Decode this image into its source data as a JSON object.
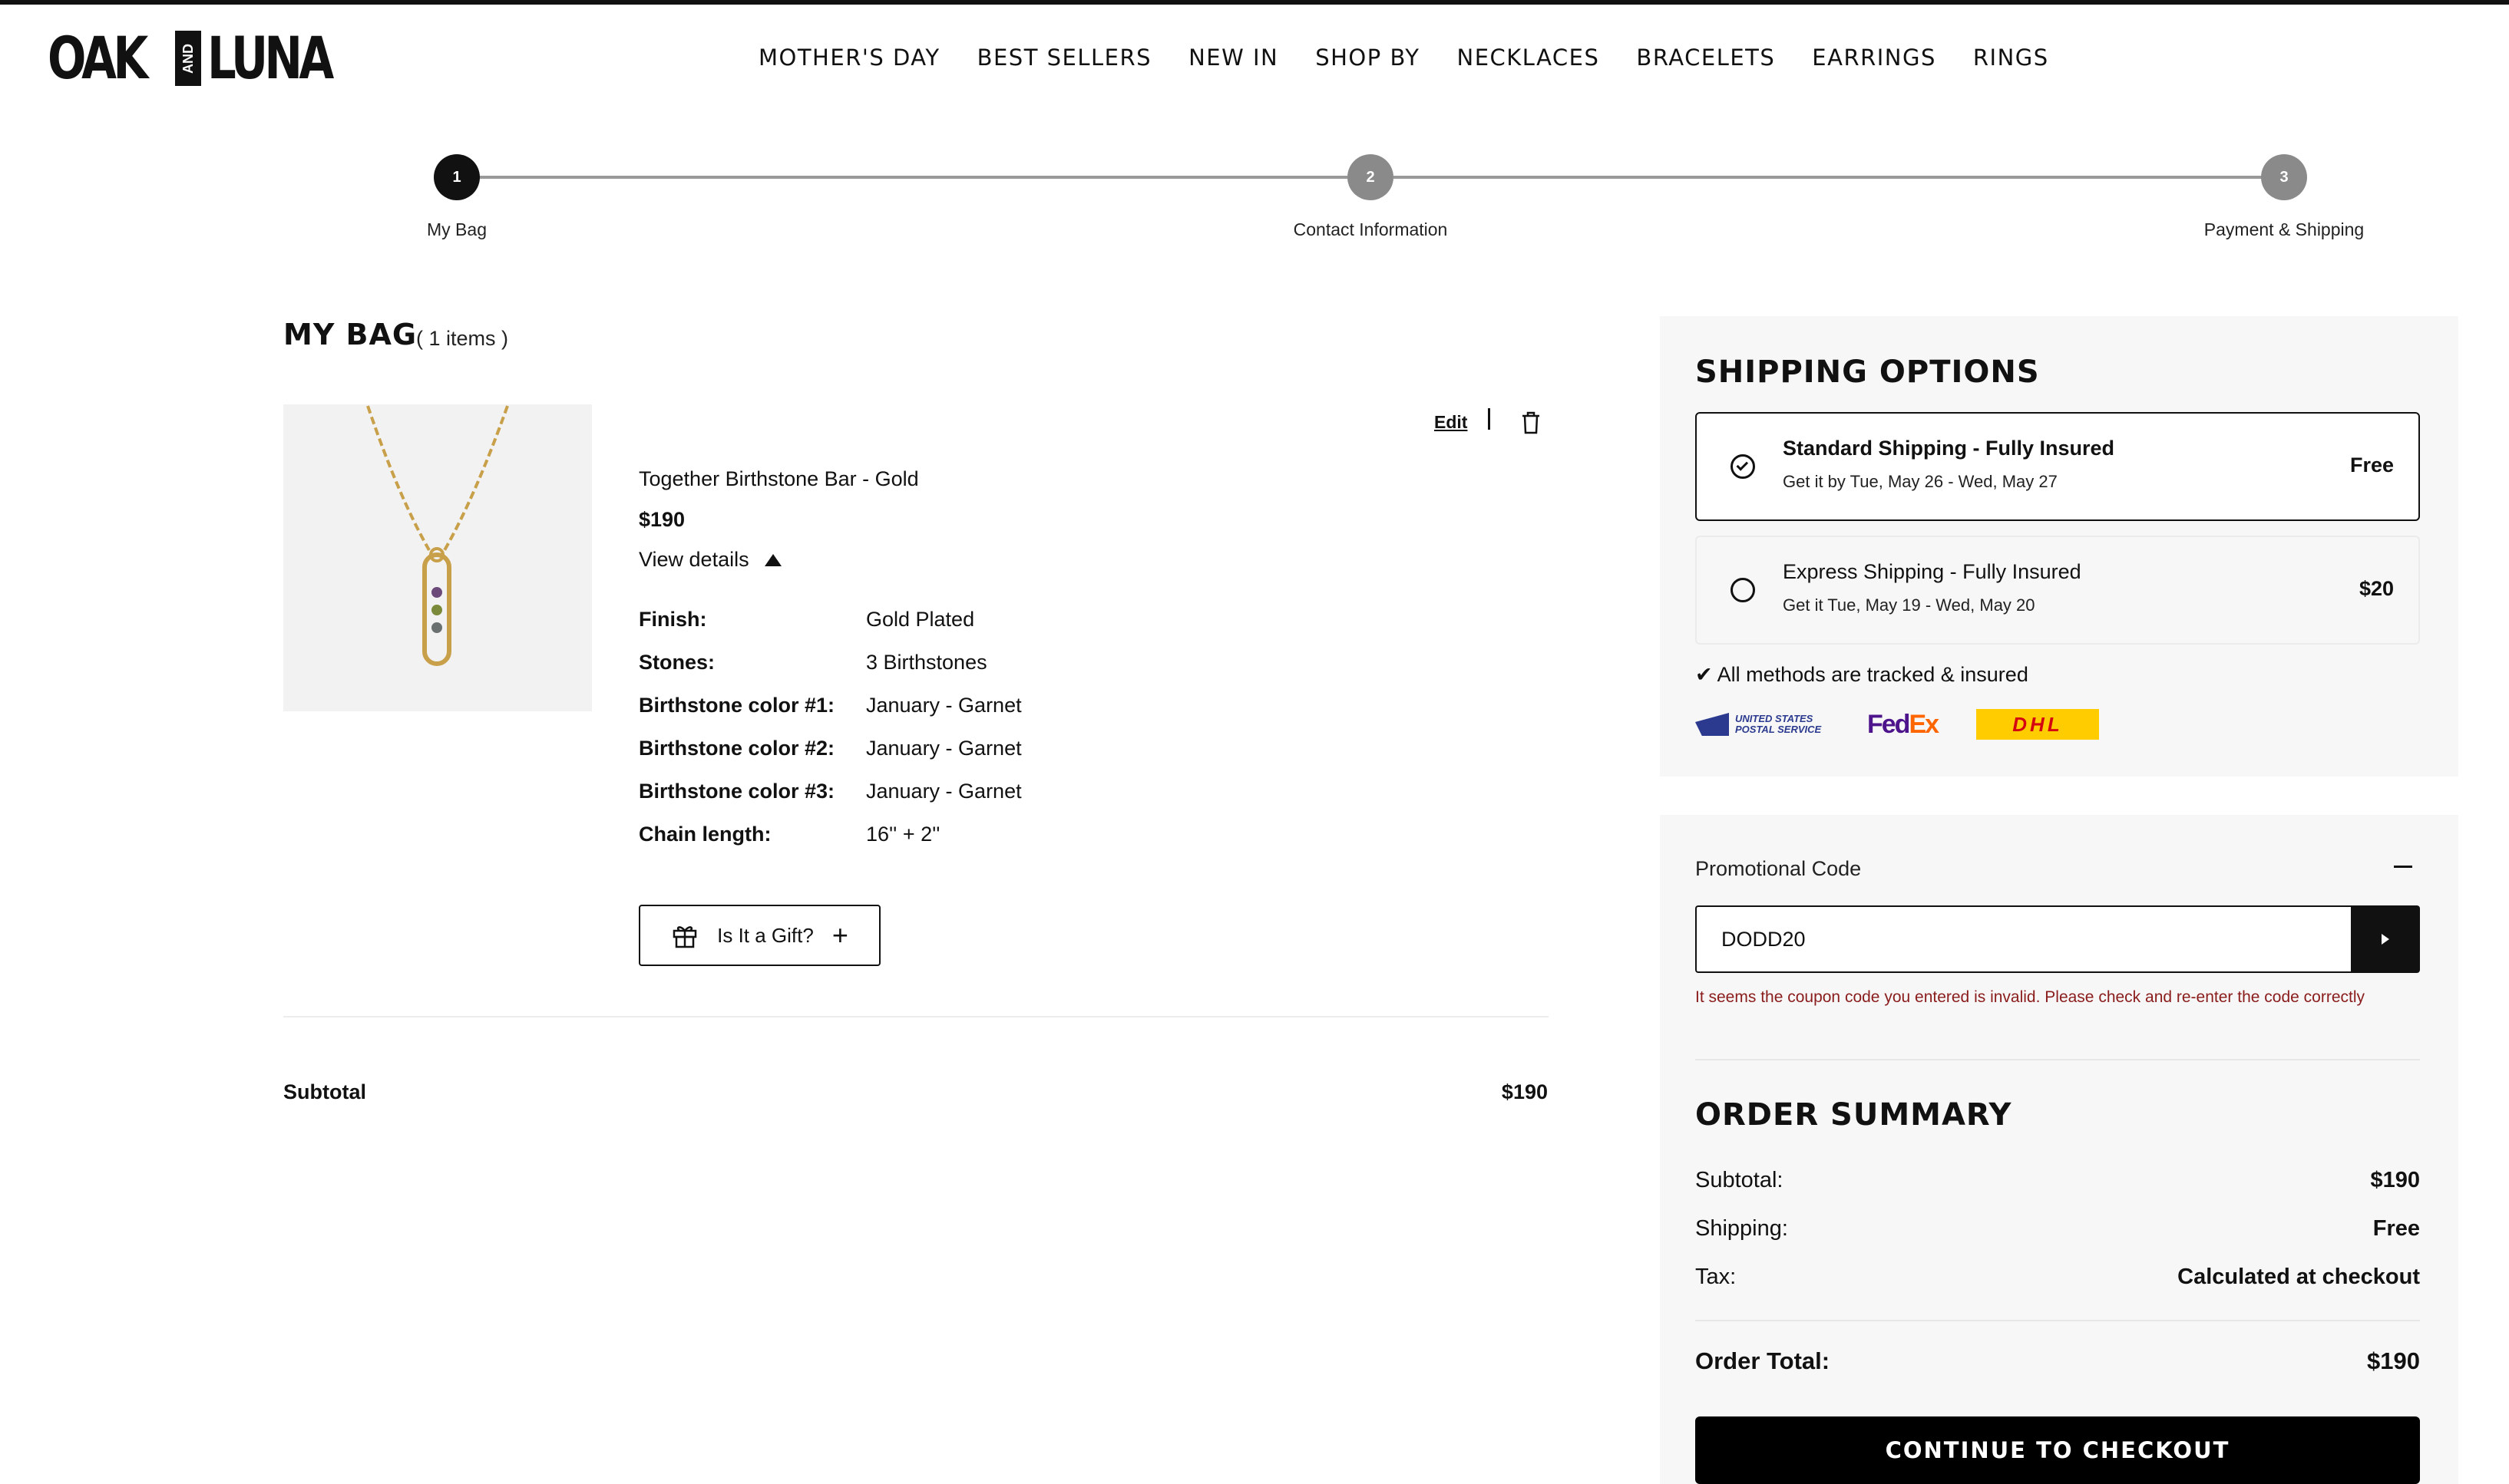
{
  "brand": {
    "logo_left": "OAK",
    "logo_and": "AND",
    "logo_right": "LUNA"
  },
  "nav": {
    "items": [
      "MOTHER'S DAY",
      "BEST SELLERS",
      "NEW IN",
      "SHOP BY",
      "NECKLACES",
      "BRACELETS",
      "EARRINGS",
      "RINGS"
    ]
  },
  "stepper": {
    "steps": [
      {
        "num": "1",
        "label": "My Bag",
        "state": "active"
      },
      {
        "num": "2",
        "label": "Contact Information",
        "state": "inactive"
      },
      {
        "num": "3",
        "label": "Payment & Shipping",
        "state": "inactive"
      }
    ]
  },
  "bag": {
    "title": "MY BAG",
    "count": "( 1 items )",
    "edit_label": "Edit",
    "item": {
      "name": "Together Birthstone Bar - Gold",
      "price": "$190",
      "view_details": "View details",
      "details": [
        {
          "k": "Finish:",
          "v": "Gold Plated"
        },
        {
          "k": "Stones:",
          "v": "3 Birthstones"
        },
        {
          "k": "Birthstone color #1:",
          "v": "January - Garnet"
        },
        {
          "k": "Birthstone color #2:",
          "v": "January - Garnet"
        },
        {
          "k": "Birthstone color #3:",
          "v": "January - Garnet"
        },
        {
          "k": "Chain length:",
          "v": "16'' + 2''"
        }
      ]
    },
    "gift_label": "Is It a Gift?",
    "subtotal_label": "Subtotal",
    "subtotal_value": "$190"
  },
  "shipping": {
    "title": "SHIPPING OPTIONS",
    "options": [
      {
        "name": "Standard Shipping - Fully Insured",
        "date": "Get it by Tue, May 26 - Wed, May 27",
        "price": "Free",
        "selected": true
      },
      {
        "name": "Express Shipping - Fully Insured",
        "date": "Get it Tue, May 19 - Wed, May 20",
        "price": "$20",
        "selected": false
      }
    ],
    "tracked_note": "✔ All methods are tracked & insured",
    "carriers": {
      "usps_line1": "UNITED STATES",
      "usps_line2": "POSTAL SERVICE",
      "fedex_fe": "Fed",
      "fedex_ex": "Ex",
      "dhl": "DHL"
    }
  },
  "promo": {
    "label": "Promotional Code",
    "value": "DODD20",
    "error": "It seems the coupon code you entered is invalid. Please check and re-enter the code correctly"
  },
  "summary": {
    "title": "ORDER SUMMARY",
    "rows": [
      {
        "label": "Subtotal:",
        "value": "$190"
      },
      {
        "label": "Shipping:",
        "value": "Free"
      },
      {
        "label": "Tax:",
        "value": "Calculated at checkout"
      }
    ],
    "total_label": "Order Total:",
    "total_value": "$190",
    "checkout_label": "CONTINUE TO CHECKOUT"
  },
  "colors": {
    "accent": "#111111",
    "error": "#8a1c1c",
    "panel": "#f7f7f7"
  }
}
